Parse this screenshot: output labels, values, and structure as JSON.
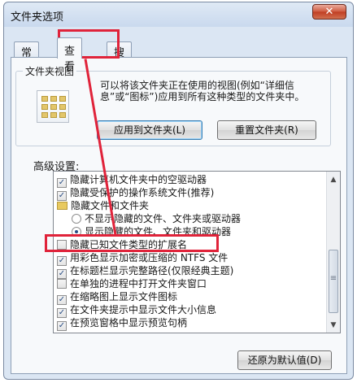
{
  "window": {
    "title": "文件夹选项",
    "close_glyph": "✕"
  },
  "tabs": [
    {
      "label": "常规",
      "active": false
    },
    {
      "label": "查看",
      "active": true
    },
    {
      "label": "搜索",
      "active": false
    }
  ],
  "folder_views": {
    "group_title": "文件夹视图",
    "description": "可以将该文件夹正在使用的视图(例如“详细信息”或“图标”)应用到所有这种类型的文件夹中。",
    "apply_button": "应用到文件夹(L)",
    "reset_button": "重置文件夹(R)"
  },
  "advanced": {
    "label": "高级设置:",
    "items": [
      {
        "type": "checkbox",
        "checked": true,
        "label": "隐藏计算机文件夹中的空驱动器"
      },
      {
        "type": "checkbox",
        "checked": true,
        "label": "隐藏受保护的操作系统文件(推荐)"
      },
      {
        "type": "folder",
        "label": "隐藏文件和文件夹"
      },
      {
        "type": "radio",
        "checked": false,
        "label": "不显示隐藏的文件、文件夹或驱动器"
      },
      {
        "type": "radio",
        "checked": true,
        "label": "显示隐藏的文件、文件夹和驱动器"
      },
      {
        "type": "checkbox",
        "checked": false,
        "label": "隐藏已知文件类型的扩展名"
      },
      {
        "type": "checkbox",
        "checked": true,
        "label": "用彩色显示加密或压缩的 NTFS 文件"
      },
      {
        "type": "checkbox",
        "checked": true,
        "label": "在标题栏显示完整路径(仅限经典主题)"
      },
      {
        "type": "checkbox",
        "checked": false,
        "label": "在单独的进程中打开文件夹窗口"
      },
      {
        "type": "checkbox",
        "checked": true,
        "label": "在缩略图上显示文件图标"
      },
      {
        "type": "checkbox",
        "checked": true,
        "label": "在文件夹提示中显示文件大小信息"
      },
      {
        "type": "checkbox",
        "checked": true,
        "label": "在预览窗格中显示预览句柄"
      }
    ],
    "restore_button": "还原为默认值(D)"
  },
  "colors": {
    "annotation": "#e0233a",
    "check": "#2b4f85"
  },
  "icons": {
    "check": "✓",
    "scroll_up": "▲",
    "scroll_down": "▼",
    "scroll_grip": "≡"
  }
}
